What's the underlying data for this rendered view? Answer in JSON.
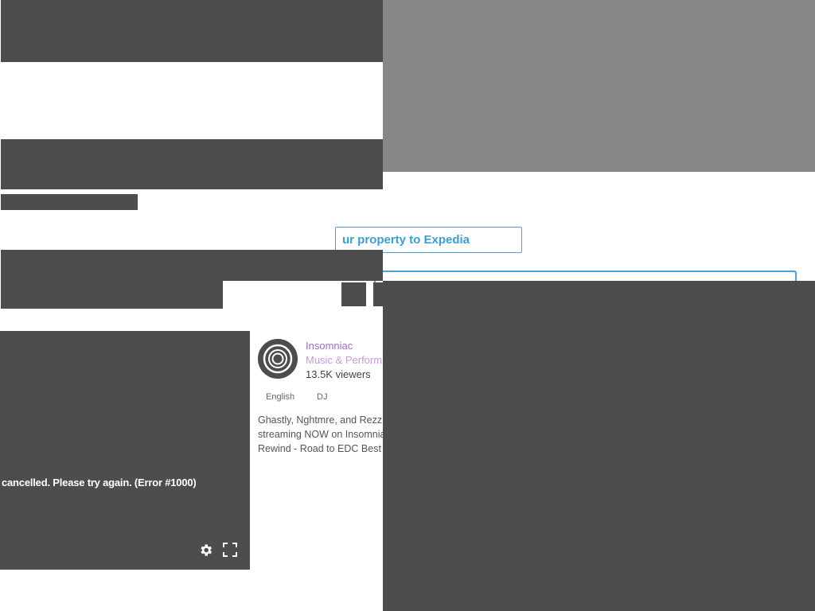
{
  "expedia": {
    "link_label": "ur property to Expedia"
  },
  "player": {
    "error_message": "cancelled. Please try again. (Error #1000)",
    "settings_icon": "gear-icon",
    "fullscreen_icon": "fullscreen-icon"
  },
  "channel": {
    "avatar_icon": "eye-logo-icon",
    "name": "Insomniac",
    "category": "Music & Performin",
    "viewers": "13.5K viewers",
    "tags": [
      "English",
      "DJ"
    ],
    "description_lines": [
      "Ghastly, Nghtmre, and Rezz",
      "streaming NOW on Insomnia",
      "Rewind - Road to EDC Best o"
    ]
  },
  "colors": {
    "placeholder_dark": "#4d4d4d",
    "placeholder_gray": "#878787",
    "link_blue": "#3a9fd6",
    "channel_purple": "#a36ac8"
  }
}
